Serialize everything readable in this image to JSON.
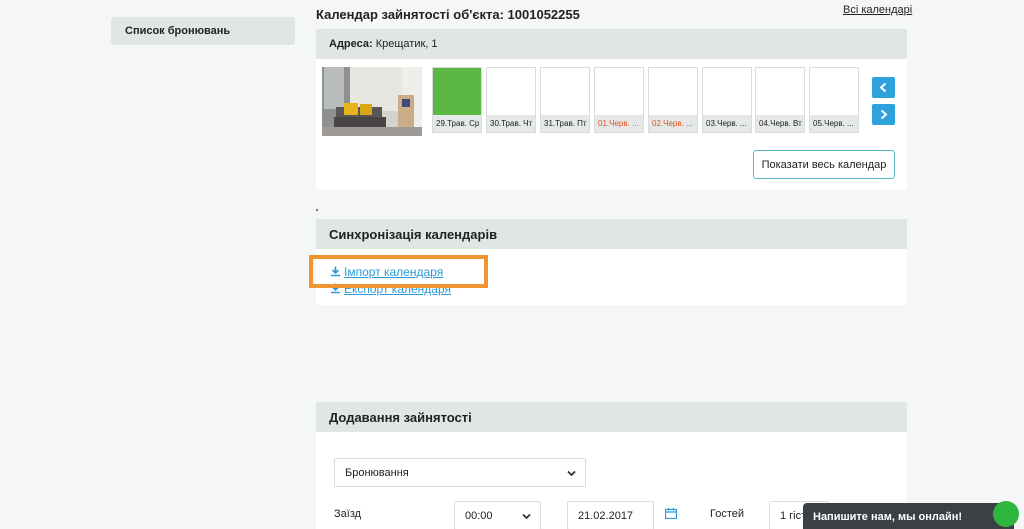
{
  "sidebar": {
    "bookings_label": "Список бронювань"
  },
  "header": {
    "title": "Календар зайнятості об'єкта: 1001052255",
    "all_calendars": "Всі календарі"
  },
  "calendar": {
    "address_label": "Адреса:",
    "address_value": "Крещатик, 1",
    "days": [
      {
        "label": "29.Трав. Ср",
        "state": "busy",
        "weekend": false
      },
      {
        "label": "30.Трав. Чт",
        "state": "free",
        "weekend": false
      },
      {
        "label": "31.Трав. Пт",
        "state": "free",
        "weekend": false
      },
      {
        "label": "01.Черв. ...",
        "state": "free",
        "weekend": true
      },
      {
        "label": "02.Черв. ...",
        "state": "free",
        "weekend": true
      },
      {
        "label": "03.Черв. ...",
        "state": "free",
        "weekend": false
      },
      {
        "label": "04.Черв. Вт",
        "state": "free",
        "weekend": false
      },
      {
        "label": "05.Черв. ...",
        "state": "free",
        "weekend": false
      }
    ],
    "show_all_label": "Показати весь календар",
    "colors": {
      "busy": "#5bb842",
      "weekend_text": "#e5531a"
    }
  },
  "sync": {
    "title": "Синхронізація календарів",
    "import_label": "Імпорт календаря",
    "export_label": "Експорт календаря"
  },
  "add": {
    "title": "Додавання зайнятості",
    "type_value": "Бронювання",
    "checkin_label": "Заїзд",
    "time_value": "00:00",
    "date_value": "21.02.2017",
    "guests_label": "Гостей",
    "guests_value": "1 гість"
  },
  "chat": {
    "label": "Напишите нам, мы онлайн!"
  }
}
